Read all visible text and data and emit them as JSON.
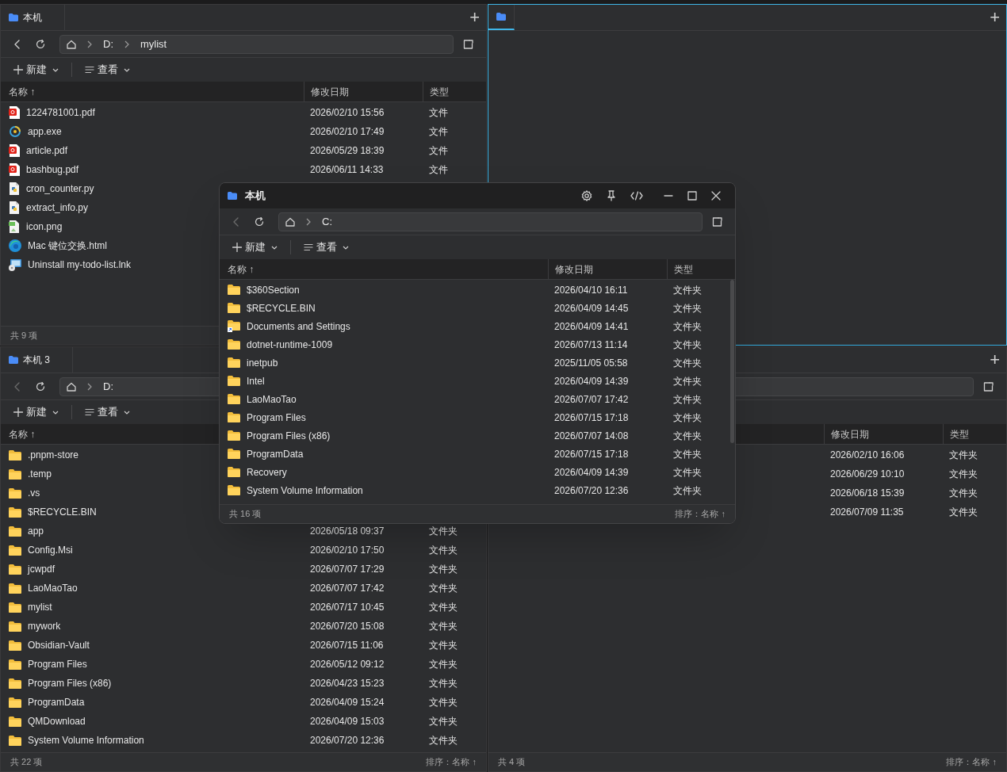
{
  "panes": [
    {
      "focused": false,
      "new_tab_button": "+",
      "tabs": [
        {
          "label": "本机",
          "selected": false
        }
      ],
      "address": {
        "kind": "full",
        "back_enabled": true,
        "crumbs": [
          "D:",
          "mylist"
        ]
      },
      "toolbar": {
        "new": "新建",
        "view": "查看"
      },
      "columns": [
        {
          "kind": "name",
          "label": "名称 ↑"
        },
        {
          "kind": "date",
          "label": "修改日期"
        },
        {
          "kind": "type",
          "label": "类型"
        }
      ],
      "rows": [
        {
          "kind": "pdf",
          "name": "1224781001.pdf",
          "date": "2026/02/10 15:56",
          "type": "文件"
        },
        {
          "kind": "exe",
          "name": "app.exe",
          "date": "2026/02/10 17:49",
          "type": "文件"
        },
        {
          "kind": "pdf",
          "name": "article.pdf",
          "date": "2026/05/29 18:39",
          "type": "文件"
        },
        {
          "kind": "pdf",
          "name": "bashbug.pdf",
          "date": "2026/06/11 14:33",
          "type": "文件"
        },
        {
          "kind": "python",
          "name": "cron_counter.py"
        },
        {
          "kind": "python",
          "name": "extract_info.py"
        },
        {
          "kind": "image",
          "name": "icon.png"
        },
        {
          "kind": "edge",
          "name": "Mac 键位交换.html"
        },
        {
          "kind": "shortcut",
          "name": "Uninstall my-todo-list.lnk"
        }
      ],
      "status": {
        "count": "共 9 项"
      }
    },
    {
      "focused": true,
      "new_tab_button": "+",
      "tabs": [
        {
          "selected": true
        }
      ]
    },
    {
      "focused": false,
      "tabs": [
        {
          "label": "本机 3",
          "selected": false
        }
      ],
      "address": {
        "kind": "left",
        "back_enabled": false,
        "crumbs": [
          "D:"
        ]
      },
      "toolbar": {
        "new": "新建",
        "view": "查看"
      },
      "columns": [
        {
          "kind": "name",
          "label": "名称 ↑"
        }
      ],
      "rows": [
        {
          "kind": "folder",
          "name": ".pnpm-store"
        },
        {
          "kind": "folder",
          "name": ".temp"
        },
        {
          "kind": "folder",
          "name": ".vs"
        },
        {
          "kind": "folder",
          "name": "$RECYCLE.BIN"
        },
        {
          "kind": "folder",
          "name": "app",
          "date": "2026/05/18 09:37",
          "type": "文件夹"
        },
        {
          "kind": "folder",
          "name": "Config.Msi",
          "date": "2026/02/10 17:50",
          "type": "文件夹"
        },
        {
          "kind": "folder",
          "name": "jcwpdf",
          "date": "2026/07/07 17:29",
          "type": "文件夹"
        },
        {
          "kind": "folder",
          "name": "LaoMaoTao",
          "date": "2026/07/07 17:42",
          "type": "文件夹"
        },
        {
          "kind": "folder",
          "name": "mylist",
          "date": "2026/07/17 10:45",
          "type": "文件夹"
        },
        {
          "kind": "folder",
          "name": "mywork",
          "date": "2026/07/20 15:08",
          "type": "文件夹"
        },
        {
          "kind": "folder",
          "name": "Obsidian-Vault",
          "date": "2026/07/15 11:06",
          "type": "文件夹"
        },
        {
          "kind": "folder",
          "name": "Program Files",
          "date": "2026/05/12 09:12",
          "type": "文件夹"
        },
        {
          "kind": "folder",
          "name": "Program Files (x86)",
          "date": "2026/04/23 15:23",
          "type": "文件夹"
        },
        {
          "kind": "folder",
          "name": "ProgramData",
          "date": "2026/04/09 15:24",
          "type": "文件夹"
        },
        {
          "kind": "folder",
          "name": "QMDownload",
          "date": "2026/04/09 15:03",
          "type": "文件夹"
        },
        {
          "kind": "folder",
          "name": "System Volume Information",
          "date": "2026/07/20 12:36",
          "type": "文件夹"
        }
      ],
      "status": {
        "count": "共 22 项",
        "sort": "排序：名称 ↑"
      }
    },
    {
      "focused": false,
      "new_tab_button": "+",
      "address": {
        "kind": "right"
      },
      "columns": [
        {
          "kind": "date",
          "label": "修改日期"
        },
        {
          "kind": "type",
          "label": "类型"
        }
      ],
      "rows": [
        {
          "date": "2026/02/10 16:06",
          "type": "文件夹"
        },
        {
          "date": "2026/06/29 10:10",
          "type": "文件夹"
        },
        {
          "date": "2026/06/18 15:39",
          "type": "文件夹"
        },
        {
          "date": "2026/07/09 11:35",
          "type": "文件夹"
        }
      ],
      "status": {
        "count": "共 4 项",
        "sort": "排序：名称 ↑"
      }
    }
  ],
  "window": {
    "title": "本机",
    "address": {
      "kind": "full",
      "back_enabled": false,
      "crumbs": [
        "C:"
      ]
    },
    "toolbar": {
      "new": "新建",
      "view": "查看"
    },
    "columns": [
      {
        "kind": "name",
        "label": "名称 ↑"
      },
      {
        "kind": "date",
        "label": "修改日期"
      },
      {
        "kind": "type",
        "label": "类型"
      }
    ],
    "rows": [
      {
        "kind": "folder",
        "name": "$360Section",
        "date": "2026/04/10 16:11",
        "type": "文件夹"
      },
      {
        "kind": "folder",
        "name": "$RECYCLE.BIN",
        "date": "2026/04/09 14:45",
        "type": "文件夹"
      },
      {
        "kind": "folder-link",
        "name": "Documents and Settings",
        "date": "2026/04/09 14:41",
        "type": "文件夹"
      },
      {
        "kind": "folder",
        "name": "dotnet-runtime-1009",
        "date": "2026/07/13 11:14",
        "type": "文件夹"
      },
      {
        "kind": "folder",
        "name": "inetpub",
        "date": "2025/11/05 05:58",
        "type": "文件夹"
      },
      {
        "kind": "folder",
        "name": "Intel",
        "date": "2026/04/09 14:39",
        "type": "文件夹"
      },
      {
        "kind": "folder",
        "name": "LaoMaoTao",
        "date": "2026/07/07 17:42",
        "type": "文件夹"
      },
      {
        "kind": "folder",
        "name": "Program Files",
        "date": "2026/07/15 17:18",
        "type": "文件夹"
      },
      {
        "kind": "folder",
        "name": "Program Files (x86)",
        "date": "2026/07/07 14:08",
        "type": "文件夹"
      },
      {
        "kind": "folder",
        "name": "ProgramData",
        "date": "2026/07/15 17:18",
        "type": "文件夹"
      },
      {
        "kind": "folder",
        "name": "Recovery",
        "date": "2026/04/09 14:39",
        "type": "文件夹"
      },
      {
        "kind": "folder",
        "name": "System Volume Information",
        "date": "2026/07/20 12:36",
        "type": "文件夹"
      }
    ],
    "status": {
      "count": "共 16 项",
      "sort": "排序：名称 ↑"
    }
  }
}
